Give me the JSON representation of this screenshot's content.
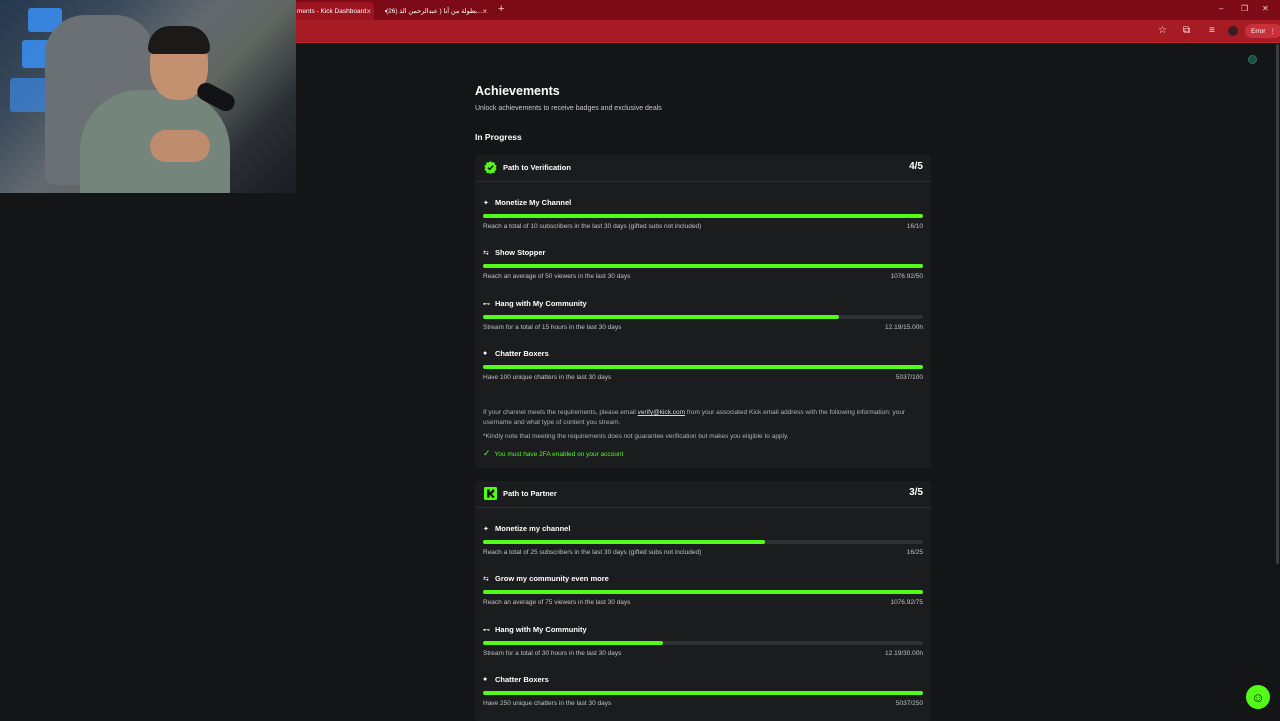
{
  "browser": {
    "tabs": [
      {
        "title": "ments - Kick Dashboard",
        "close": "×"
      },
      {
        "title": "(26) بطولة من أنا ( عبدالرحمن الذ...",
        "close": "×"
      }
    ],
    "new_tab": "+",
    "window_controls": [
      "–",
      "❐",
      "✕"
    ],
    "error_button": "Error",
    "menu_dots": "⋮"
  },
  "page": {
    "title": "Achievements",
    "subtitle": "Unlock achievements to receive badges and exclusive deals",
    "section": "In Progress"
  },
  "verification": {
    "title": "Path to Verification",
    "count": "4/5",
    "items": [
      {
        "name": "Monetize My Channel",
        "desc": "Reach a total of 10 subscribers in the last 30 days (gifted subs not included)",
        "value": "16/10",
        "progress": 1.0
      },
      {
        "name": "Show Stopper",
        "desc": "Reach an average of 50 viewers in the last 30 days",
        "value": "1076.92/50",
        "progress": 1.0
      },
      {
        "name": "Hang with My Community",
        "desc": "Stream for a total of 15 hours in the last 30 days",
        "value": "12.19/15.00h",
        "progress": 0.81
      },
      {
        "name": "Chatter Boxers",
        "desc": "Have 100 unique chatters in the last 30 days",
        "value": "5037/100",
        "progress": 1.0
      }
    ],
    "note_pre": "If your channel meets the requirements, please email",
    "note_email": "verify@kick.com",
    "note_post": "from your associated Kick email address with the following information: your username and what type of content you stream.",
    "disclaimer": "*Kindly note that meeting the requirements does not guarantee verification but makes you eligible to apply.",
    "twofa": "You must have 2FA enabled on your account"
  },
  "partner": {
    "title": "Path to Partner",
    "count": "3/5",
    "items": [
      {
        "name": "Monetize my channel",
        "desc": "Reach a total of 25 subscribers in the last 30 days (gifted subs not included)",
        "value": "16/25",
        "progress": 0.64
      },
      {
        "name": "Grow my community even more",
        "desc": "Reach an average of 75 viewers in the last 30 days",
        "value": "1076.92/75",
        "progress": 1.0
      },
      {
        "name": "Hang with My Community",
        "desc": "Stream for a total of 30 hours in the last 30 days",
        "value": "12.19/30.00h",
        "progress": 0.41
      },
      {
        "name": "Chatter Boxers",
        "desc": "Have 250 unique chatters in the last 30 days",
        "value": "5037/250",
        "progress": 1.0
      }
    ]
  },
  "colors": {
    "accent": "#53fc18",
    "chrome": "#a61b24",
    "background": "#141517"
  },
  "icons": {
    "support": "support-chat-icon"
  }
}
